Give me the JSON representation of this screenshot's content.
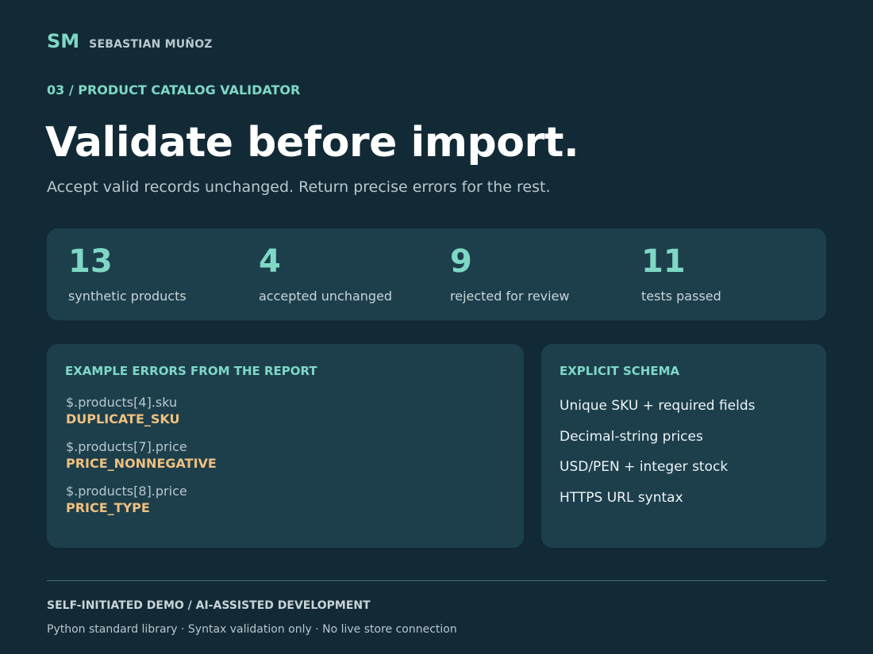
{
  "brand": {
    "mark": "SM",
    "name": "SEBASTIAN MUÑOZ"
  },
  "eyebrow": "03 / PRODUCT CATALOG VALIDATOR",
  "headline": "Validate before import.",
  "subline": "Accept valid records unchanged. Return precise errors for the rest.",
  "stats": [
    {
      "value": "13",
      "label": "synthetic products"
    },
    {
      "value": "4",
      "label": "accepted unchanged"
    },
    {
      "value": "9",
      "label": "rejected for review"
    },
    {
      "value": "11",
      "label": "tests passed"
    }
  ],
  "errors_card": {
    "title": "EXAMPLE ERRORS FROM THE REPORT",
    "errors": [
      {
        "path": "$.products[4].sku",
        "code": "DUPLICATE_SKU"
      },
      {
        "path": "$.products[7].price",
        "code": "PRICE_NONNEGATIVE"
      },
      {
        "path": "$.products[8].price",
        "code": "PRICE_TYPE"
      }
    ]
  },
  "schema_card": {
    "title": "EXPLICIT SCHEMA",
    "items": [
      "Unique SKU + required fields",
      "Decimal-string prices",
      "USD/PEN + integer stock",
      "HTTPS URL syntax"
    ]
  },
  "footer": {
    "title": "SELF-INITIATED DEMO / AI-ASSISTED DEVELOPMENT",
    "note": "Python standard library · Syntax validation only · No live store connection"
  },
  "colors": {
    "background": "#122a36",
    "card": "#1d3f4c",
    "accent": "#7fd8c6",
    "error_code": "#f0c07e"
  }
}
